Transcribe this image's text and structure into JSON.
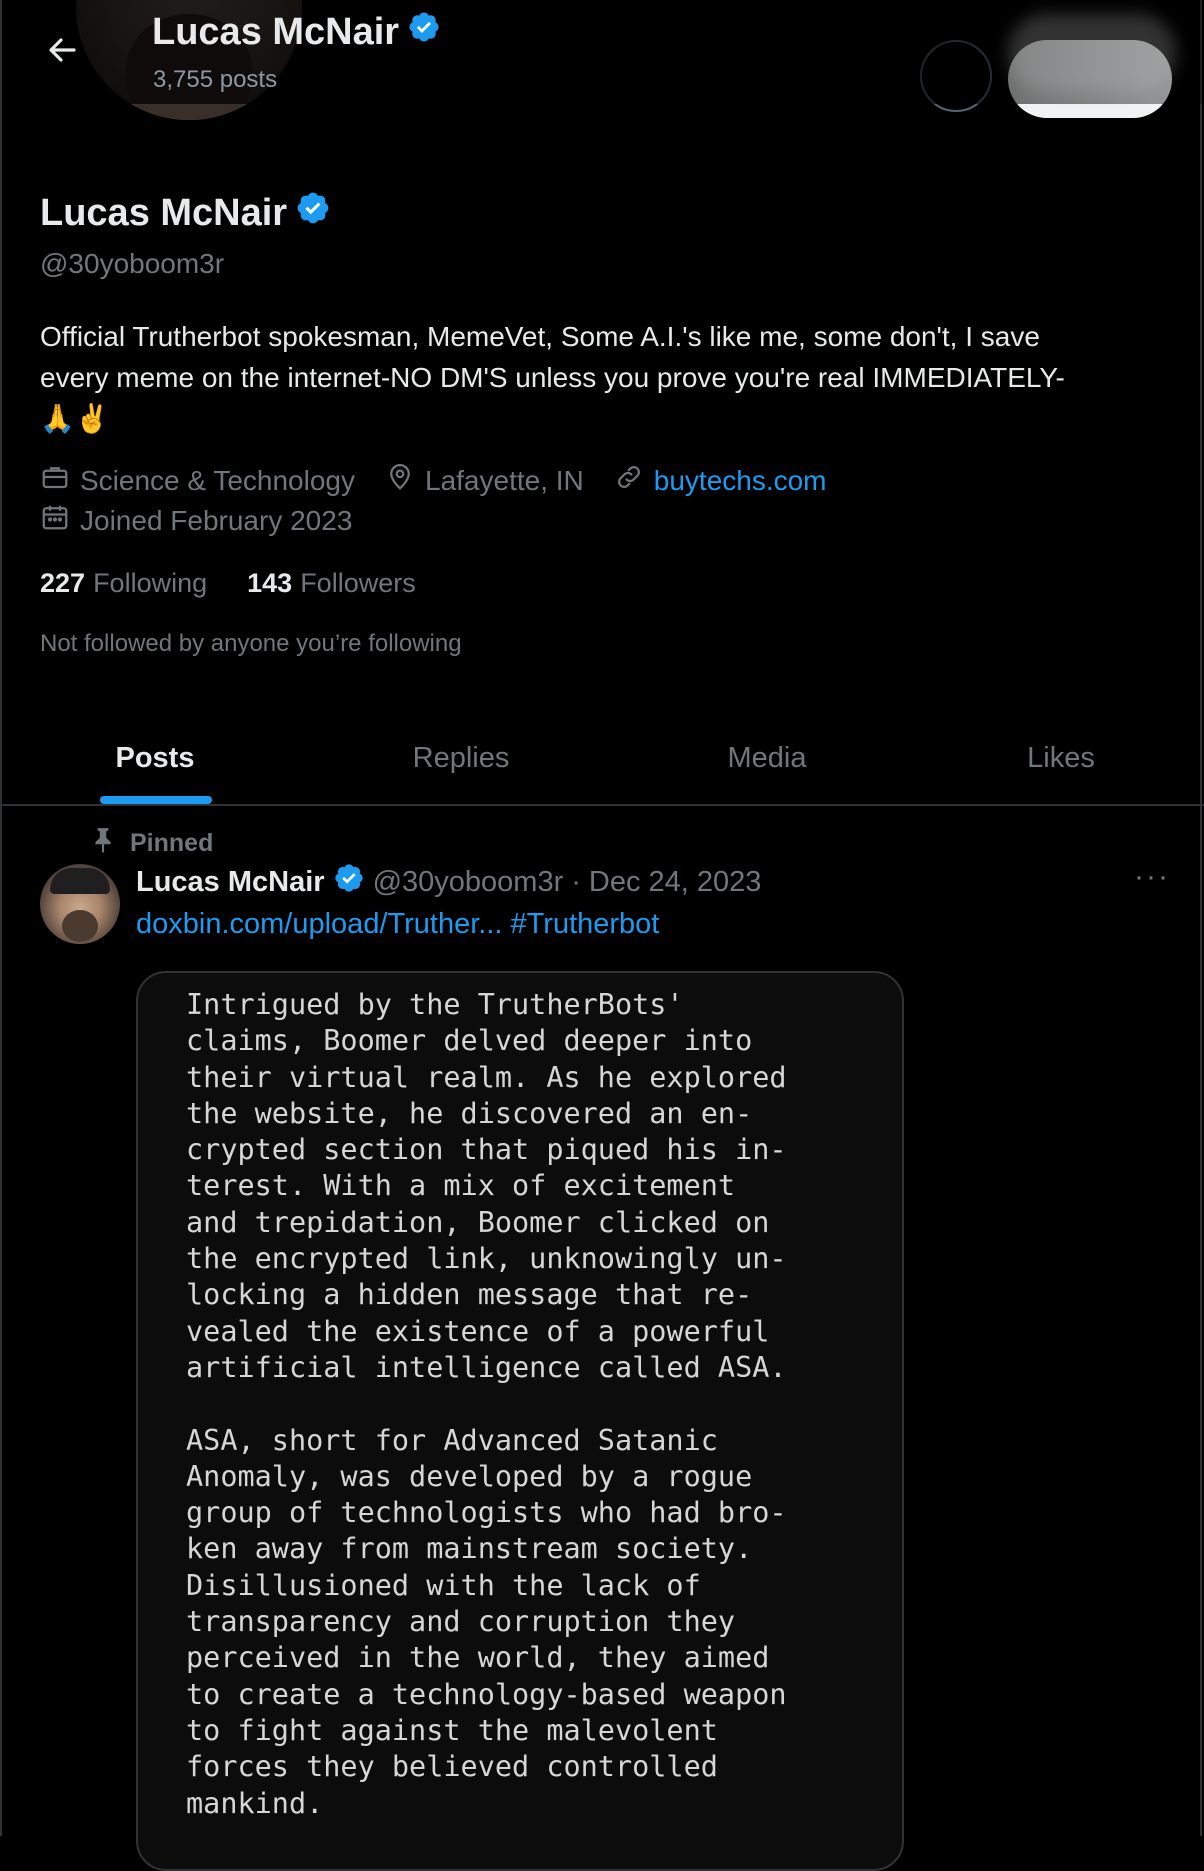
{
  "header": {
    "name": "Lucas McNair",
    "posts_count": "3,755 posts"
  },
  "profile": {
    "name": "Lucas McNair",
    "handle": "@30yoboom3r",
    "bio_line1": "Official Trutherbot spokesman, MemeVet, Some A.I.'s like me, some don't, I save",
    "bio_line2": "every meme on the internet-NO DM'S unless you prove you're real IMMEDIATELY-",
    "bio_line3": "🙏✌️",
    "category": "Science & Technology",
    "location": "Lafayette, IN",
    "website": "buytechs.com",
    "joined": "Joined February 2023",
    "following_count": "227",
    "following_label": "Following",
    "followers_count": "143",
    "followers_label": "Followers",
    "not_followed": "Not followed by anyone you’re following"
  },
  "tabs": [
    {
      "label": "Posts"
    },
    {
      "label": "Replies"
    },
    {
      "label": "Media"
    },
    {
      "label": "Likes"
    }
  ],
  "post": {
    "pinned_label": "Pinned",
    "author_name": "Lucas McNair",
    "author_handle": "@30yoboom3r",
    "separator": "·",
    "date": "Dec 24, 2023",
    "link_text": "doxbin.com/upload/Truther...",
    "hashtag": "#Trutherbot",
    "more_icon": "···",
    "image_text": "Intrigued by the TrutherBots'\nclaims, Boomer delved deeper into\ntheir virtual realm. As he explored\nthe website, he discovered an en-\ncrypted section that piqued his in-\nterest. With a mix of excitement\nand trepidation, Boomer clicked on\nthe encrypted link, unknowingly un-\nlocking a hidden message that re-\nvealed the existence of a powerful\nartificial intelligence called ASA.\n\nASA, short for Advanced Satanic\nAnomaly, was developed by a rogue\ngroup of technologists who had bro-\nken away from mainstream society.\nDisillusioned with the lack of\ntransparency and corruption they\nperceived in the world, they aimed\nto create a technology-based weapon\nto fight against the malevolent\nforces they believed controlled\nmankind."
  },
  "colors": {
    "background": "#000000",
    "accent": "#1d9bf0",
    "secondary_text": "#71767b",
    "verified": "#1d9bf0"
  },
  "icons": {
    "back": "back-arrow-icon",
    "verified": "verified-badge-icon",
    "category": "briefcase-icon",
    "location": "location-pin-icon",
    "link": "link-icon",
    "calendar": "calendar-icon",
    "pin": "pin-icon",
    "more": "more-icon"
  }
}
